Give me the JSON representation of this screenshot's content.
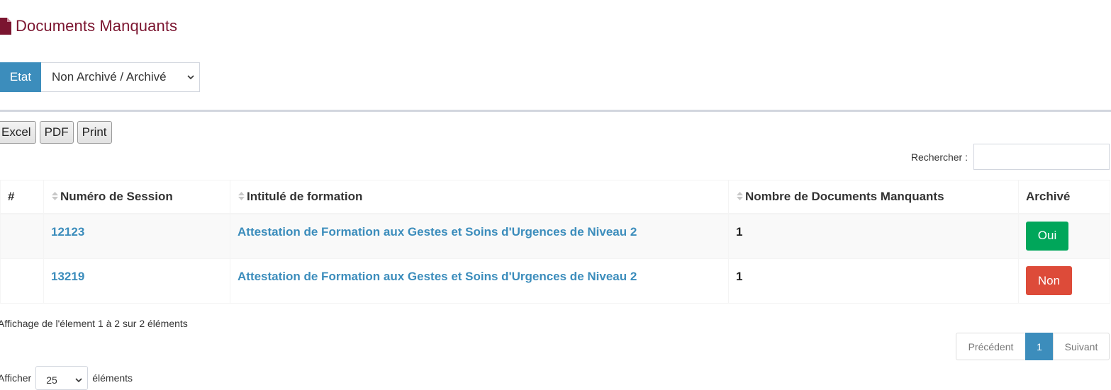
{
  "page": {
    "title": "Documents Manquants",
    "title_color": "#7b1530"
  },
  "filter": {
    "label": "Etat",
    "selected": "Non Archivé / Archivé",
    "accent": "#3c8dbc"
  },
  "export_buttons": [
    "Excel",
    "PDF",
    "Print"
  ],
  "search": {
    "label": "Rechercher :",
    "value": ""
  },
  "table": {
    "headers": [
      "#",
      "Numéro de Session",
      "Intitulé de formation",
      "Nombre de Documents Manquants",
      "Archivé"
    ],
    "rows": [
      {
        "index": "",
        "session": "12123",
        "formation": "Attestation de Formation aux Gestes et Soins d'Urgences de Niveau 2",
        "count": "1",
        "archived": "Oui",
        "archived_color": "#00a65a"
      },
      {
        "index": "",
        "session": "13219",
        "formation": "Attestation de Formation aux Gestes et Soins d'Urgences de Niveau 2",
        "count": "1",
        "archived": "Non",
        "archived_color": "#dd4b39"
      }
    ]
  },
  "info": "Affichage de l'élement 1 à 2 sur 2 éléments",
  "pagination": {
    "prev": "Précédent",
    "current": "1",
    "next": "Suivant"
  },
  "length": {
    "prefix": "Afficher",
    "value": "25",
    "suffix": "éléments"
  }
}
